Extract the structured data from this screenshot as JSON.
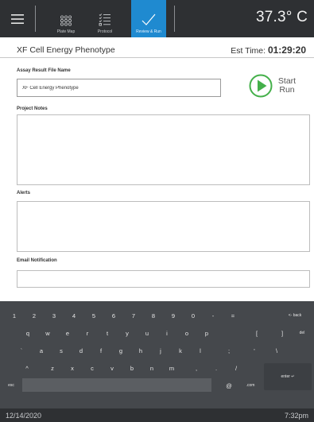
{
  "topbar": {
    "tabs": [
      {
        "label": "Plate Map",
        "icon": "plate-map-icon"
      },
      {
        "label": "Protocol",
        "icon": "protocol-icon"
      },
      {
        "label": "Review & Run",
        "icon": "checkmark-icon"
      }
    ],
    "temperature": "37.3° C"
  },
  "header": {
    "assay_title": "XF Cell Energy Phenotype",
    "est_time_label": "Est Time:",
    "est_time_value": "01:29:20"
  },
  "form": {
    "file_name_label": "Assay Result File Name",
    "file_name_value": "XF Cell Energy Phenotype",
    "start_run_label": "Start Run",
    "project_notes_label": "Project Notes",
    "alerts_label": "Alerts",
    "email_label": "Email Notification"
  },
  "keyboard": {
    "row1": [
      "1",
      "2",
      "3",
      "4",
      "5",
      "6",
      "7",
      "8",
      "9",
      "0",
      "-",
      "="
    ],
    "backspace": "<- back",
    "row2": [
      "q",
      "w",
      "e",
      "r",
      "t",
      "y",
      "u",
      "i",
      "o",
      "p",
      "[",
      "]"
    ],
    "del": "del",
    "row3": [
      "`",
      "a",
      "s",
      "d",
      "f",
      "g",
      "h",
      "j",
      "k",
      "l",
      ";",
      "'",
      "\\"
    ],
    "row4": [
      "^",
      "z",
      "x",
      "c",
      "v",
      "b",
      "n",
      "m",
      ",",
      ".",
      "/"
    ],
    "enter": "enter ↵",
    "esc": "esc",
    "at": "@",
    "dotcom": ".com"
  },
  "statusbar": {
    "date": "12/14/2020",
    "time": "7:32pm"
  },
  "colors": {
    "topbar_bg": "#2e3033",
    "active_tab": "#1f8ad0",
    "start_run_green": "#44b04a",
    "keyboard_bg": "#45484c"
  }
}
